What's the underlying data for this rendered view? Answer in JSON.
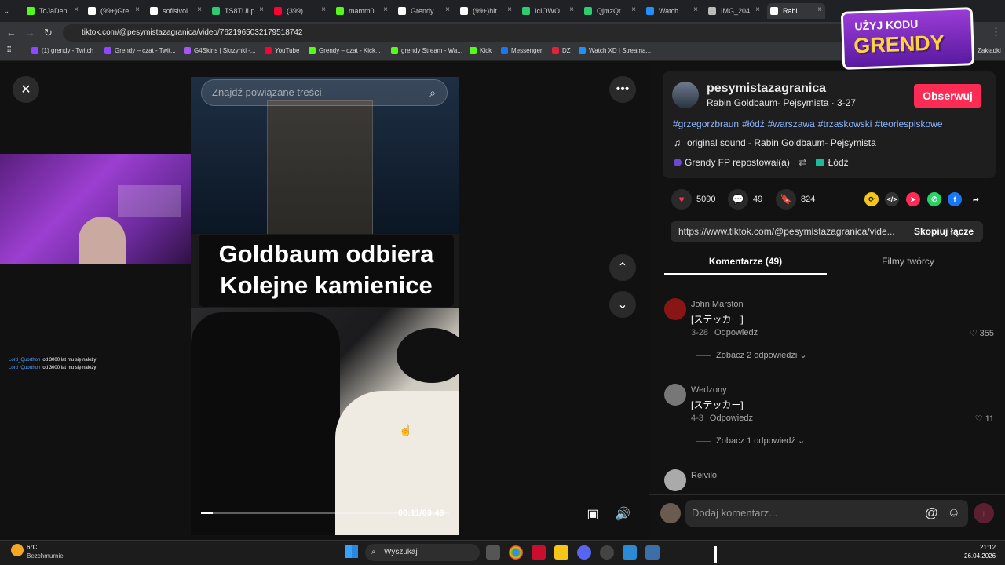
{
  "browser": {
    "tabs": [
      {
        "label": "ToJaDen",
        "color": "#53fc18"
      },
      {
        "label": "(99+)Gre",
        "color": "#ffffff"
      },
      {
        "label": "sofisivoi",
        "color": "#ffffff"
      },
      {
        "label": "TS8TUI.p",
        "color": "#2ecc71"
      },
      {
        "label": "(399)",
        "color": "#ff0033"
      },
      {
        "label": "mamm0",
        "color": "#53fc18"
      },
      {
        "label": "Grendy",
        "color": "#ffffff"
      },
      {
        "label": "(99+)hit",
        "color": "#ffffff"
      },
      {
        "label": "IcIOWO",
        "color": "#2ecc71"
      },
      {
        "label": "QjmzQt",
        "color": "#2ecc71"
      },
      {
        "label": "Watch",
        "color": "#1e90ff"
      },
      {
        "label": "IMG_204",
        "color": "#bbbbbb"
      },
      {
        "label": "Rabi",
        "color": "#ffffff"
      }
    ],
    "url": "tiktok.com/@pesymistazagranica/video/7621965032179518742",
    "bookmarks": [
      {
        "label": "(1) grendy - Twitch",
        "color": "#9146ff"
      },
      {
        "label": "Grendy – czat - Twit...",
        "color": "#9146ff"
      },
      {
        "label": "G4Skins | Skrzynki -...",
        "color": "#a855f7"
      },
      {
        "label": "YouTube",
        "color": "#ff0033"
      },
      {
        "label": "Grendy – czat - Kick...",
        "color": "#53fc18"
      },
      {
        "label": "grendy Stream - Wa...",
        "color": "#53fc18"
      },
      {
        "label": "Kick",
        "color": "#53fc18"
      },
      {
        "label": "Messenger",
        "color": "#1877f2"
      },
      {
        "label": "DZ",
        "color": "#e0233c"
      },
      {
        "label": "Watch XD | Streama...",
        "color": "#1e90ff"
      }
    ],
    "bookmarks_folder": "Zakładki"
  },
  "video": {
    "search_placeholder": "Znajdź powiązane treści",
    "caption_line1": "Goldbaum odbiera",
    "caption_line2": "Kolejne kamienice",
    "time": "00:11/03:49",
    "progress": 0.048
  },
  "stream_chat": [
    {
      "user": "Lord_Quorthon",
      "text": "od 3000 lat mu się należy"
    },
    {
      "user": "Lord_Quorthon",
      "text": "od 3000 lat mu się należy"
    }
  ],
  "author": {
    "handle": "pesymistazagranica",
    "subtitle": "Rabin Goldbaum- Pejsymista · 3-27",
    "follow_label": "Obserwuj"
  },
  "hashtags": [
    "#grzegorzbraun",
    "#łódź",
    "#warszawa",
    "#trzaskowski",
    "#teoriespiskowe"
  ],
  "sound": "original sound - Rabin Goldbaum- Pejsymista",
  "repost": {
    "by": "Grendy FP repostował(a)",
    "location": "Łódź"
  },
  "stats": {
    "likes": "5090",
    "comments": "49",
    "saves": "824"
  },
  "share_colors": [
    "#f5c518",
    "#333333",
    "#fe2c55",
    "#25d366",
    "#1877f2"
  ],
  "link": {
    "url": "https://www.tiktok.com/@pesymistazagranica/vide...",
    "copy_label": "Skopiuj łącze"
  },
  "panel_tabs": {
    "comments": "Komentarze (49)",
    "creator": "Filmy twórcy"
  },
  "comments": [
    {
      "name": "John Marston",
      "body": "[ステッカー]",
      "date": "3-28",
      "reply": "Odpowiedz",
      "likes": "355",
      "more": "Zobacz 2 odpowiedzi",
      "avatar": "#8a1515"
    },
    {
      "name": "Wedzony",
      "body": "[ステッカー]",
      "date": "4-3",
      "reply": "Odpowiedz",
      "likes": "11",
      "more": "Zobacz 1 odpowiedź",
      "avatar": "#777777"
    },
    {
      "name": "Reivilo",
      "body": "",
      "date": "",
      "reply": "",
      "likes": "",
      "more": "",
      "avatar": "#aaaaaa"
    }
  ],
  "add_comment_placeholder": "Dodaj komentarz...",
  "promo": {
    "line1": "UŻYJ KODU",
    "line2": "GRENDY"
  },
  "taskbar": {
    "weather_temp": "6°C",
    "weather_desc": "Bezchmurnie",
    "search": "Wyszukaj",
    "time": "21:12",
    "date": "26.04.2026"
  }
}
